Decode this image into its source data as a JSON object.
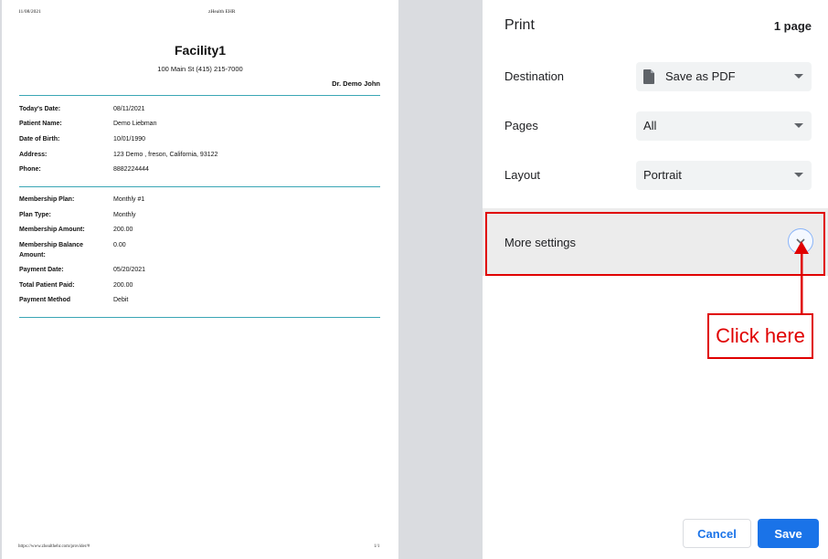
{
  "preview": {
    "header_date": "11/08/2021",
    "header_app": "zHealth EHR",
    "facility_name": "Facility1",
    "facility_address": "100 Main St  (415) 215-7000",
    "doctor": "Dr. Demo John",
    "patient_rows": [
      {
        "label": "Today's Date:",
        "value": "08/11/2021"
      },
      {
        "label": "Patient Name:",
        "value": "Demo Liebman"
      },
      {
        "label": "Date of Birth:",
        "value": "10/01/1990"
      },
      {
        "label": "Address:",
        "value": "123 Demo , freson, California, 93122"
      },
      {
        "label": "Phone:",
        "value": "8882224444"
      }
    ],
    "membership_rows": [
      {
        "label": "Membership Plan:",
        "value": "Monthly #1"
      },
      {
        "label": "Plan Type:",
        "value": "Monthly"
      },
      {
        "label": "Membership Amount:",
        "value": "200.00"
      },
      {
        "label": "Membership Balance Amount:",
        "value": "0.00"
      },
      {
        "label": "Payment Date:",
        "value": "05/20/2021"
      },
      {
        "label": "Total Patient Paid:",
        "value": "200.00"
      },
      {
        "label": "Payment Method",
        "value": "Debit"
      }
    ],
    "footer_url": "https://www.zhealthehr.com/provider/#",
    "footer_page": "1/1"
  },
  "panel": {
    "title": "Print",
    "page_count": "1 page",
    "destination_label": "Destination",
    "destination_value": "Save as PDF",
    "pages_label": "Pages",
    "pages_value": "All",
    "layout_label": "Layout",
    "layout_value": "Portrait",
    "more_settings_label": "More settings",
    "annotation": "Click here",
    "cancel_label": "Cancel",
    "save_label": "Save"
  },
  "colors": {
    "accent": "#1a73e8",
    "annotation_red": "#e00000",
    "rule_teal": "#3aa6b5"
  },
  "icons": {
    "destination": "file-icon",
    "more_settings": "chevron-down-icon",
    "dropdown": "caret-down-icon"
  }
}
